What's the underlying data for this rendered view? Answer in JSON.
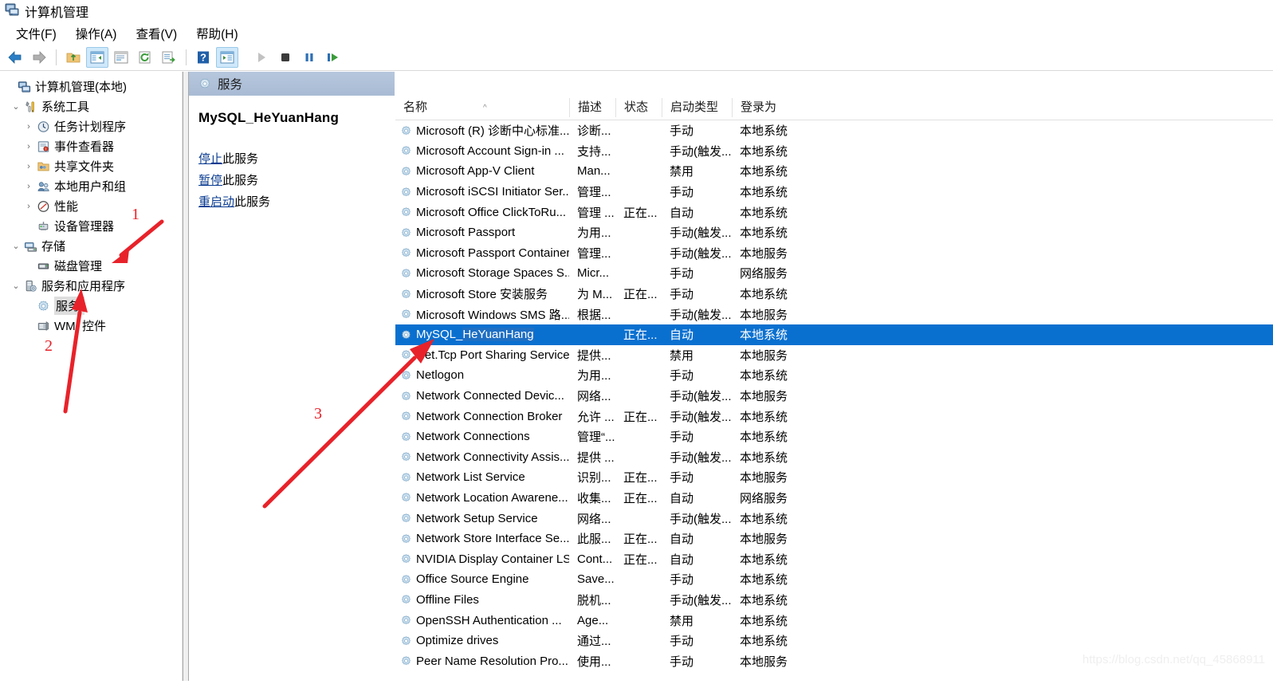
{
  "window": {
    "title": "计算机管理",
    "app_icon": "computer-management-icon"
  },
  "menubar": {
    "items": [
      {
        "label": "文件(F)",
        "name": "menu-file"
      },
      {
        "label": "操作(A)",
        "name": "menu-action"
      },
      {
        "label": "查看(V)",
        "name": "menu-view"
      },
      {
        "label": "帮助(H)",
        "name": "menu-help"
      }
    ]
  },
  "toolbar": {
    "buttons": [
      {
        "icon": "back-arrow-icon",
        "name": "toolbar-back"
      },
      {
        "icon": "forward-arrow-icon",
        "name": "toolbar-forward"
      },
      {
        "icon": "up-folder-icon",
        "name": "toolbar-up-level"
      },
      {
        "icon": "show-hide-tree-icon",
        "name": "toolbar-show-hide-console-tree"
      },
      {
        "icon": "properties-icon",
        "name": "toolbar-properties"
      },
      {
        "icon": "refresh-icon",
        "name": "toolbar-refresh"
      },
      {
        "icon": "export-list-icon",
        "name": "toolbar-export-list"
      },
      {
        "icon": "help-icon",
        "name": "toolbar-help"
      },
      {
        "icon": "show-action-pane-icon",
        "name": "toolbar-show-action-pane"
      },
      {
        "icon": "play-icon",
        "name": "toolbar-start-service"
      },
      {
        "icon": "stop-icon",
        "name": "toolbar-stop-service"
      },
      {
        "icon": "pause-icon",
        "name": "toolbar-pause-service"
      },
      {
        "icon": "restart-icon",
        "name": "toolbar-restart-service"
      }
    ]
  },
  "tree": {
    "items": [
      {
        "label": "计算机管理(本地)",
        "indent": 0,
        "twisty": "",
        "icon": "computer-icon",
        "name": "tree-computer-management-local",
        "selected": false
      },
      {
        "label": "系统工具",
        "indent": 1,
        "twisty": "v",
        "icon": "system-tools-icon",
        "name": "tree-system-tools",
        "selected": false
      },
      {
        "label": "任务计划程序",
        "indent": 2,
        "twisty": ">",
        "icon": "task-scheduler-icon",
        "name": "tree-task-scheduler",
        "selected": false
      },
      {
        "label": "事件查看器",
        "indent": 2,
        "twisty": ">",
        "icon": "event-viewer-icon",
        "name": "tree-event-viewer",
        "selected": false
      },
      {
        "label": "共享文件夹",
        "indent": 2,
        "twisty": ">",
        "icon": "shared-folders-icon",
        "name": "tree-shared-folders",
        "selected": false
      },
      {
        "label": "本地用户和组",
        "indent": 2,
        "twisty": ">",
        "icon": "local-users-icon",
        "name": "tree-local-users-and-groups",
        "selected": false
      },
      {
        "label": "性能",
        "indent": 2,
        "twisty": ">",
        "icon": "performance-icon",
        "name": "tree-performance",
        "selected": false
      },
      {
        "label": "设备管理器",
        "indent": 2,
        "twisty": "",
        "icon": "device-manager-icon",
        "name": "tree-device-manager",
        "selected": false
      },
      {
        "label": "存储",
        "indent": 1,
        "twisty": "v",
        "icon": "storage-icon",
        "name": "tree-storage",
        "selected": false
      },
      {
        "label": "磁盘管理",
        "indent": 2,
        "twisty": "",
        "icon": "disk-management-icon",
        "name": "tree-disk-management",
        "selected": false
      },
      {
        "label": "服务和应用程序",
        "indent": 1,
        "twisty": "v",
        "icon": "services-apps-icon",
        "name": "tree-services-and-applications",
        "selected": false
      },
      {
        "label": "服务",
        "indent": 2,
        "twisty": "",
        "icon": "gear-icon",
        "name": "tree-services",
        "selected": true
      },
      {
        "label": "WMI 控件",
        "indent": 2,
        "twisty": "",
        "icon": "wmi-control-icon",
        "name": "tree-wmi-control",
        "selected": false
      }
    ]
  },
  "pane": {
    "header_title": "服务",
    "header_icon": "gear-icon"
  },
  "detail": {
    "service_name": "MySQL_HeYuanHang",
    "actions": [
      {
        "link": "停止",
        "suffix": "此服务",
        "name": "stop-service-link"
      },
      {
        "link": "暂停",
        "suffix": "此服务",
        "name": "pause-service-link"
      },
      {
        "link": "重启动",
        "suffix": "此服务",
        "name": "restart-service-link"
      }
    ]
  },
  "list": {
    "columns": [
      {
        "label": "名称",
        "name": "column-header-name",
        "sorted": "asc"
      },
      {
        "label": "描述",
        "name": "column-header-description"
      },
      {
        "label": "状态",
        "name": "column-header-status"
      },
      {
        "label": "启动类型",
        "name": "column-header-startup-type"
      },
      {
        "label": "登录为",
        "name": "column-header-log-on-as"
      }
    ],
    "sort_arrow": "^",
    "rows": [
      {
        "name": "Microsoft (R) 诊断中心标准...",
        "desc": "诊断...",
        "state": "",
        "startup": "手动",
        "logon": "本地系统",
        "selected": false
      },
      {
        "name": "Microsoft Account Sign-in ...",
        "desc": "支持...",
        "state": "",
        "startup": "手动(触发...",
        "logon": "本地系统",
        "selected": false
      },
      {
        "name": "Microsoft App-V Client",
        "desc": "Man...",
        "state": "",
        "startup": "禁用",
        "logon": "本地系统",
        "selected": false
      },
      {
        "name": "Microsoft iSCSI Initiator Ser...",
        "desc": "管理...",
        "state": "",
        "startup": "手动",
        "logon": "本地系统",
        "selected": false
      },
      {
        "name": "Microsoft Office ClickToRu...",
        "desc": "管理 ...",
        "state": "正在...",
        "startup": "自动",
        "logon": "本地系统",
        "selected": false
      },
      {
        "name": "Microsoft Passport",
        "desc": "为用...",
        "state": "",
        "startup": "手动(触发...",
        "logon": "本地系统",
        "selected": false
      },
      {
        "name": "Microsoft Passport Container",
        "desc": "管理...",
        "state": "",
        "startup": "手动(触发...",
        "logon": "本地服务",
        "selected": false
      },
      {
        "name": "Microsoft Storage Spaces S...",
        "desc": "Micr...",
        "state": "",
        "startup": "手动",
        "logon": "网络服务",
        "selected": false
      },
      {
        "name": "Microsoft Store 安装服务",
        "desc": "为 M...",
        "state": "正在...",
        "startup": "手动",
        "logon": "本地系统",
        "selected": false
      },
      {
        "name": "Microsoft Windows SMS 路...",
        "desc": "根据...",
        "state": "",
        "startup": "手动(触发...",
        "logon": "本地服务",
        "selected": false
      },
      {
        "name": "MySQL_HeYuanHang",
        "desc": "",
        "state": "正在...",
        "startup": "自动",
        "logon": "本地系统",
        "selected": true,
        "redacted": true
      },
      {
        "name": "Net.Tcp Port Sharing Service",
        "desc": "提供...",
        "state": "",
        "startup": "禁用",
        "logon": "本地服务",
        "selected": false
      },
      {
        "name": "Netlogon",
        "desc": "为用...",
        "state": "",
        "startup": "手动",
        "logon": "本地系统",
        "selected": false
      },
      {
        "name": "Network Connected Devic...",
        "desc": "网络...",
        "state": "",
        "startup": "手动(触发...",
        "logon": "本地服务",
        "selected": false
      },
      {
        "name": "Network Connection Broker",
        "desc": "允许 ...",
        "state": "正在...",
        "startup": "手动(触发...",
        "logon": "本地系统",
        "selected": false
      },
      {
        "name": "Network Connections",
        "desc": "管理“...",
        "state": "",
        "startup": "手动",
        "logon": "本地系统",
        "selected": false
      },
      {
        "name": "Network Connectivity Assis...",
        "desc": "提供 ...",
        "state": "",
        "startup": "手动(触发...",
        "logon": "本地系统",
        "selected": false
      },
      {
        "name": "Network List Service",
        "desc": "识别...",
        "state": "正在...",
        "startup": "手动",
        "logon": "本地服务",
        "selected": false
      },
      {
        "name": "Network Location Awarene...",
        "desc": "收集...",
        "state": "正在...",
        "startup": "自动",
        "logon": "网络服务",
        "selected": false
      },
      {
        "name": "Network Setup Service",
        "desc": "网络...",
        "state": "",
        "startup": "手动(触发...",
        "logon": "本地系统",
        "selected": false
      },
      {
        "name": "Network Store Interface Se...",
        "desc": "此服...",
        "state": "正在...",
        "startup": "自动",
        "logon": "本地服务",
        "selected": false
      },
      {
        "name": "NVIDIA Display Container LS",
        "desc": "Cont...",
        "state": "正在...",
        "startup": "自动",
        "logon": "本地系统",
        "selected": false
      },
      {
        "name": "Office  Source Engine",
        "desc": "Save...",
        "state": "",
        "startup": "手动",
        "logon": "本地系统",
        "selected": false
      },
      {
        "name": "Offline Files",
        "desc": "脱机...",
        "state": "",
        "startup": "手动(触发...",
        "logon": "本地系统",
        "selected": false
      },
      {
        "name": "OpenSSH Authentication ...",
        "desc": "Age...",
        "state": "",
        "startup": "禁用",
        "logon": "本地系统",
        "selected": false
      },
      {
        "name": "Optimize drives",
        "desc": "通过...",
        "state": "",
        "startup": "手动",
        "logon": "本地系统",
        "selected": false
      },
      {
        "name": "Peer Name Resolution Pro...",
        "desc": "使用...",
        "state": "",
        "startup": "手动",
        "logon": "本地服务",
        "selected": false
      }
    ]
  },
  "annotations": {
    "color": "#e8222a",
    "markers": [
      {
        "label": "1",
        "name": "annotation-number-1"
      },
      {
        "label": "2",
        "name": "annotation-number-2"
      },
      {
        "label": "3",
        "name": "annotation-number-3"
      }
    ]
  },
  "watermark": {
    "text": "https://blog.csdn.net/qq_45868911"
  }
}
